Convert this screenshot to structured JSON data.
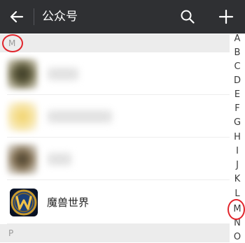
{
  "header": {
    "title": "公众号",
    "back_icon": "arrow-left-icon",
    "search_icon": "search-icon",
    "add_icon": "plus-icon"
  },
  "sections": {
    "m": {
      "label": "M"
    },
    "p": {
      "label": "P"
    }
  },
  "list": {
    "items": [
      {
        "name": "",
        "avatar": "blurred"
      },
      {
        "name": "",
        "avatar": "blurred"
      },
      {
        "name": "",
        "avatar": "blurred"
      },
      {
        "name": "魔兽世界",
        "avatar": "wow-logo"
      }
    ]
  },
  "index": {
    "letters": [
      "A",
      "B",
      "C",
      "D",
      "E",
      "F",
      "G",
      "H",
      "I",
      "J",
      "K",
      "L",
      "M",
      "N",
      "O"
    ],
    "highlighted": "M"
  },
  "colors": {
    "topbar": "#2f3033",
    "section_bg": "#ececec",
    "annotation": "#e1242b"
  }
}
